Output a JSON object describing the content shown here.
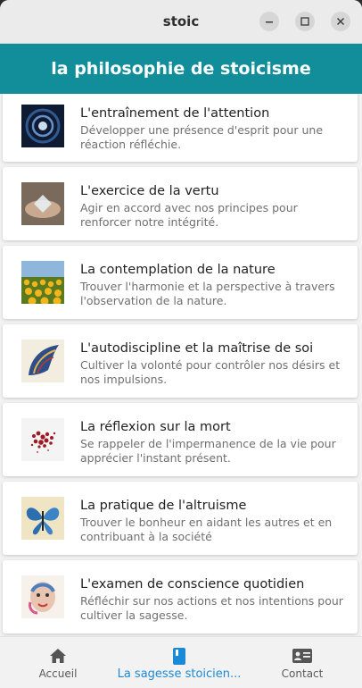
{
  "window": {
    "title": "stoic",
    "minimize_icon": "minimize-icon",
    "maximize_icon": "maximize-icon",
    "close_icon": "close-icon"
  },
  "appbar": {
    "title": "la philosophie de stoicisme"
  },
  "practices": [
    {
      "title": "L'entraînement de l'attention",
      "description": "Développer une présence d'esprit pour une réaction réfléchie.",
      "image": "spiral-galaxy-image"
    },
    {
      "title": "L'exercice de la vertu",
      "description": "Agir en accord avec nos principes pour renforcer notre intégrité.",
      "image": "hands-crystal-image"
    },
    {
      "title": "La contemplation de la nature",
      "description": "Trouver l'harmonie et la perspective à travers l'observation de la nature.",
      "image": "sunflower-field-image"
    },
    {
      "title": "L'autodiscipline et la maîtrise de soi",
      "description": "Cultiver la volonté pour contrôler nos désirs et nos impulsions.",
      "image": "wing-image"
    },
    {
      "title": "La réflexion sur la mort",
      "description": "Se rappeler de l'impermanence de la vie pour apprécier l'instant présent.",
      "image": "red-particles-image"
    },
    {
      "title": "La pratique de l'altruisme",
      "description": "Trouver le bonheur en aidant les autres et en contribuant à la société",
      "image": "butterfly-image"
    },
    {
      "title": " L'examen de conscience quotidien",
      "description": "Réfléchir sur nos actions et nos intentions pour cultiver la sagesse.",
      "image": "face-art-image"
    }
  ],
  "bottom_nav": {
    "items": [
      {
        "label": "Accueil",
        "icon": "home-icon"
      },
      {
        "label": "La sagesse stoicien...",
        "icon": "book-icon",
        "active": true
      },
      {
        "label": "Contact",
        "icon": "contact-card-icon"
      }
    ],
    "active_color": "#1b8ad6"
  },
  "colors": {
    "appbar": "#128e9b",
    "titlebar": "#ebebeb"
  }
}
